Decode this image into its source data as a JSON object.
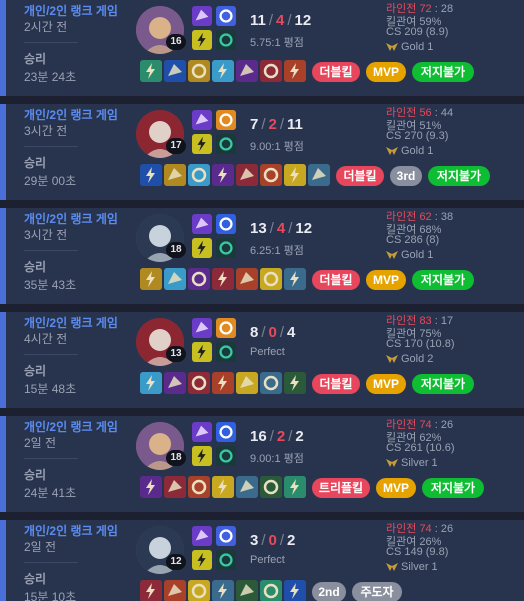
{
  "colors": {
    "accent": "#4a6fd8",
    "death": "#e74a5c",
    "mvp": "#e6a300",
    "green": "#0fbd32",
    "red_badge": "#e8465c"
  },
  "matches": [
    {
      "type": "개인/2인 랭크 게임",
      "ago": "2시간 전",
      "result": "승리",
      "duration": "23분 24초",
      "level": "16",
      "kills": "11",
      "deaths": "4",
      "assists": "12",
      "ratio": "5.75:1 평점",
      "lane_label": "라인전",
      "lane_win": "72",
      "lane_sep": ":",
      "lane_loss": "28",
      "kp": "킬관여 59%",
      "cs": "CS 209 (8.9)",
      "rank": "Gold 1",
      "badges": [
        {
          "label": "더블킬",
          "color": "red"
        },
        {
          "label": "MVP",
          "color": "gold"
        },
        {
          "label": "저지불가",
          "color": "green"
        }
      ],
      "items_count": 7
    },
    {
      "type": "개인/2인 랭크 게임",
      "ago": "3시간 전",
      "result": "승리",
      "duration": "29분 00초",
      "level": "17",
      "kills": "7",
      "deaths": "2",
      "assists": "11",
      "ratio": "9.00:1 평점",
      "lane_label": "라인전",
      "lane_win": "56",
      "lane_sep": ":",
      "lane_loss": "44",
      "kp": "킬관여 51%",
      "cs": "CS 270 (9.3)",
      "rank": "Gold 1",
      "badges": [
        {
          "label": "더블킬",
          "color": "red"
        },
        {
          "label": "3rd",
          "color": "grey"
        },
        {
          "label": "저지불가",
          "color": "green"
        }
      ],
      "items_count": 8
    },
    {
      "type": "개인/2인 랭크 게임",
      "ago": "3시간 전",
      "result": "승리",
      "duration": "35분 43초",
      "level": "18",
      "kills": "13",
      "deaths": "4",
      "assists": "12",
      "ratio": "6.25:1 평점",
      "lane_label": "라인전",
      "lane_win": "62",
      "lane_sep": ":",
      "lane_loss": "38",
      "kp": "킬관여 68%",
      "cs": "CS 286 (8)",
      "rank": "Gold 1",
      "badges": [
        {
          "label": "더블킬",
          "color": "red"
        },
        {
          "label": "MVP",
          "color": "gold"
        },
        {
          "label": "저지불가",
          "color": "green"
        }
      ],
      "items_count": 7
    },
    {
      "type": "개인/2인 랭크 게임",
      "ago": "4시간 전",
      "result": "승리",
      "duration": "15분 48초",
      "level": "13",
      "kills": "8",
      "deaths": "0",
      "assists": "4",
      "ratio": "Perfect",
      "lane_label": "라인전",
      "lane_win": "83",
      "lane_sep": ":",
      "lane_loss": "17",
      "kp": "킬관여 75%",
      "cs": "CS 170 (10.8)",
      "rank": "Gold 2",
      "badges": [
        {
          "label": "더블킬",
          "color": "red"
        },
        {
          "label": "MVP",
          "color": "gold"
        },
        {
          "label": "저지불가",
          "color": "green"
        }
      ],
      "items_count": 7
    },
    {
      "type": "개인/2인 랭크 게임",
      "ago": "2일 전",
      "result": "승리",
      "duration": "24분 41초",
      "level": "18",
      "kills": "16",
      "deaths": "2",
      "assists": "2",
      "ratio": "9.00:1 평점",
      "lane_label": "라인전",
      "lane_win": "74",
      "lane_sep": ":",
      "lane_loss": "26",
      "kp": "킬관여 62%",
      "cs": "CS 261 (10.6)",
      "rank": "Silver 1",
      "badges": [
        {
          "label": "트리플킬",
          "color": "red"
        },
        {
          "label": "MVP",
          "color": "gold"
        },
        {
          "label": "저지불가",
          "color": "green"
        }
      ],
      "items_count": 7
    },
    {
      "type": "개인/2인 랭크 게임",
      "ago": "2일 전",
      "result": "승리",
      "duration": "15분 10초",
      "level": "12",
      "kills": "3",
      "deaths": "0",
      "assists": "2",
      "ratio": "Perfect",
      "lane_label": "라인전",
      "lane_win": "74",
      "lane_sep": ":",
      "lane_loss": "26",
      "kp": "킬관여 26%",
      "cs": "CS 149 (9.8)",
      "rank": "Silver 1",
      "badges": [
        {
          "label": "2nd",
          "color": "grey"
        },
        {
          "label": "주도자",
          "color": "grey"
        }
      ],
      "items_count": 7
    }
  ]
}
